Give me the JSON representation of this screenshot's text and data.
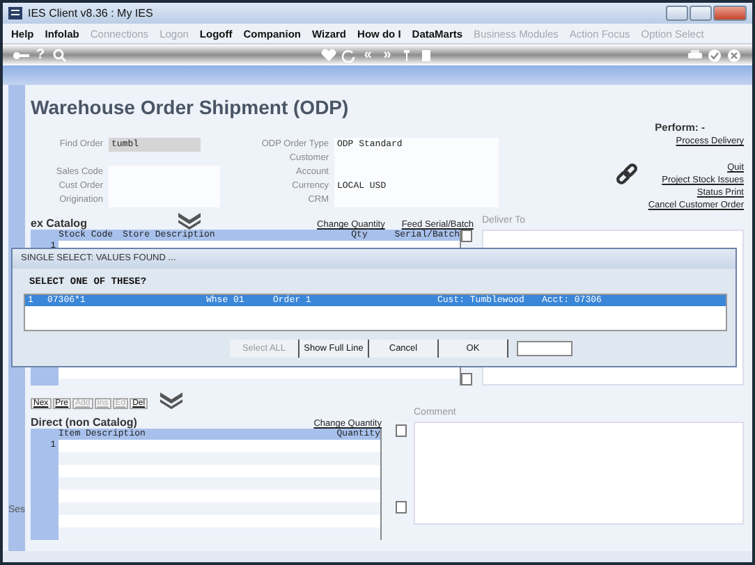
{
  "window": {
    "title": "IES Client v8.36 : My IES"
  },
  "menu": [
    {
      "label": "Help",
      "disabled": false
    },
    {
      "label": "Infolab",
      "disabled": false
    },
    {
      "label": "Connections",
      "disabled": true
    },
    {
      "label": "Logon",
      "disabled": true
    },
    {
      "label": "Logoff",
      "disabled": false
    },
    {
      "label": "Companion",
      "disabled": false
    },
    {
      "label": "Wizard",
      "disabled": false
    },
    {
      "label": "How do I",
      "disabled": false
    },
    {
      "label": "DataMarts",
      "disabled": false
    },
    {
      "label": "Business Modules",
      "disabled": true
    },
    {
      "label": "Action Focus",
      "disabled": true
    },
    {
      "label": "Option Select",
      "disabled": true
    }
  ],
  "toolbar": [
    {
      "kind": "key"
    },
    {
      "kind": "glyph",
      "text": "?"
    },
    {
      "kind": "search"
    },
    {
      "kind": "heart"
    },
    {
      "kind": "refresh"
    },
    {
      "kind": "glyph",
      "text": "«"
    },
    {
      "kind": "glyph",
      "text": "»"
    },
    {
      "kind": "pin"
    },
    {
      "kind": "square"
    },
    {
      "kind": "print"
    },
    {
      "kind": "check"
    },
    {
      "kind": "close"
    }
  ],
  "page_title": "Warehouse Order Shipment (ODP)",
  "form_rows": [
    {
      "left": {
        "label": "Find Order",
        "value": "tumbl",
        "kind": "lookup"
      },
      "right": {
        "label": "ODP Order Type",
        "value": "ODP Standard"
      }
    },
    {
      "right": {
        "label": "Customer"
      }
    },
    {
      "left": {
        "label": "Sales Code",
        "kind": "text"
      },
      "right": {
        "label": "Account"
      }
    },
    {
      "left": {
        "label": "Cust Order",
        "kind": "text"
      },
      "right": {
        "label": "Currency",
        "value": "LOCAL USD"
      }
    },
    {
      "left": {
        "label": "Origination",
        "kind": "text"
      },
      "right": {
        "label": "CRM"
      }
    }
  ],
  "perform": {
    "label": "Perform: -",
    "primary_action": "Process Delivery",
    "actions": [
      "Quit",
      "Project Stock Issues",
      "Status Print",
      "Cancel Customer Order"
    ]
  },
  "catalog": {
    "title": "ex Catalog",
    "links": [
      "Change Quantity",
      "Feed Serial/Batch"
    ],
    "columns": [
      "Stock Code",
      "Store Description",
      "Qty",
      "Serial/Batch"
    ],
    "rows": [
      "1"
    ]
  },
  "deliver_to": {
    "label": "Deliver To"
  },
  "record_buttons": [
    {
      "label": "Nex",
      "disabled": false
    },
    {
      "label": "Pre",
      "disabled": false
    },
    {
      "label": "Add",
      "disabled": true
    },
    {
      "label": "Ins",
      "disabled": true
    },
    {
      "label": "Ed",
      "disabled": true
    },
    {
      "label": "Del",
      "disabled": false
    }
  ],
  "direct": {
    "title": "Direct (non Catalog)",
    "link": "Change Quantity",
    "columns": [
      "Item Description",
      "Quantity"
    ],
    "rows": [
      "1"
    ]
  },
  "comment": {
    "label": "Comment"
  },
  "side_label": "Ses",
  "dialog": {
    "title": "SINGLE SELECT: VALUES FOUND ...",
    "prompt": "SELECT ONE OF THESE?",
    "rows": [
      {
        "cells": [
          "1",
          "07306*1",
          "Whse 01",
          "Order 1",
          "Cust: Tumblewood",
          "Acct: 07306"
        ],
        "selected": true
      }
    ],
    "buttons": [
      {
        "label": "Select ALL",
        "disabled": true
      },
      {
        "label": "Show Full Line",
        "disabled": false
      },
      {
        "label": "Cancel",
        "disabled": false
      },
      {
        "label": "OK",
        "disabled": false
      }
    ]
  }
}
